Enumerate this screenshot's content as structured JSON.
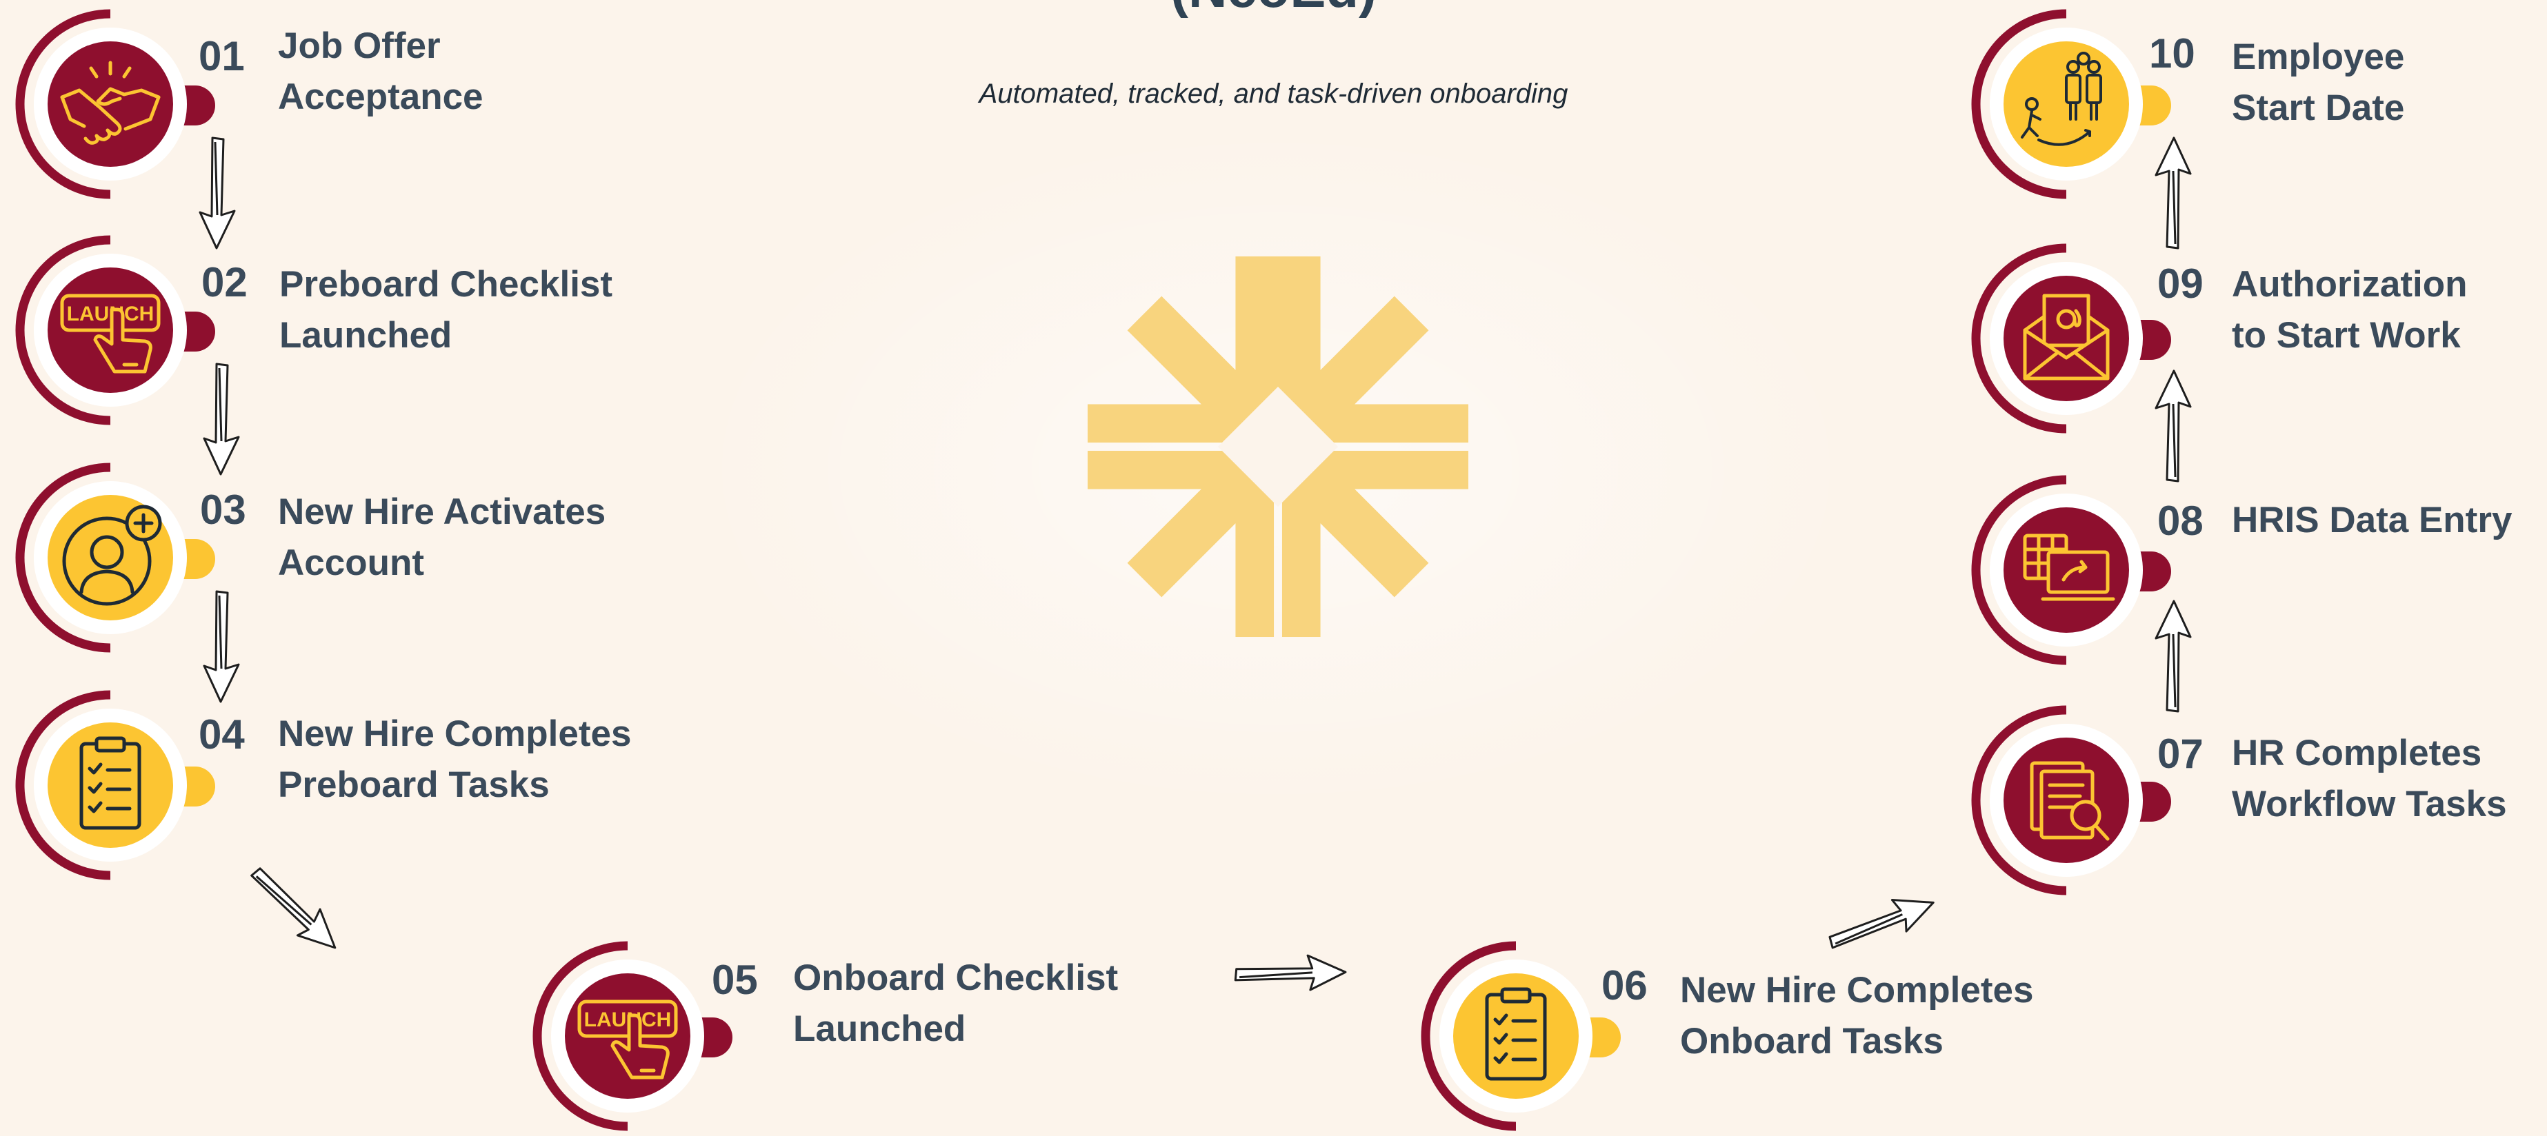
{
  "title": "(NeoEd)",
  "subtitle": "Automated, tracked, and task-driven onboarding",
  "colors": {
    "maroon": "#8e0f2e",
    "gold": "#fcc532",
    "text": "#3a4a5a",
    "background": "#fcf4eb",
    "logo": "#f8d47e"
  },
  "steps": [
    {
      "num": "01",
      "line1": "Job Offer",
      "line2": "Acceptance",
      "icon": "handshake-icon",
      "fill": "maroon"
    },
    {
      "num": "02",
      "line1": "Preboard Checklist",
      "line2": "Launched",
      "icon": "launch-button-icon",
      "fill": "maroon"
    },
    {
      "num": "03",
      "line1": "New Hire Activates",
      "line2": "Account",
      "icon": "add-user-icon",
      "fill": "gold"
    },
    {
      "num": "04",
      "line1": "New Hire Completes",
      "line2": "Preboard Tasks",
      "icon": "checklist-clipboard-icon",
      "fill": "gold"
    },
    {
      "num": "05",
      "line1": "Onboard Checklist",
      "line2": "Launched",
      "icon": "launch-button-icon",
      "fill": "maroon"
    },
    {
      "num": "06",
      "line1": "New Hire Completes",
      "line2": "Onboard Tasks",
      "icon": "checklist-clipboard-icon",
      "fill": "gold"
    },
    {
      "num": "07",
      "line1": "HR Completes",
      "line2": "Workflow Tasks",
      "icon": "document-search-icon",
      "fill": "maroon"
    },
    {
      "num": "08",
      "line1": "HRIS Data Entry",
      "line2": "",
      "icon": "data-entry-computer-icon",
      "fill": "maroon"
    },
    {
      "num": "09",
      "line1": "Authorization",
      "line2": "to Start Work",
      "icon": "email-envelope-icon",
      "fill": "maroon"
    },
    {
      "num": "10",
      "line1": "Employee",
      "line2": "Start Date",
      "icon": "team-onboarding-icon",
      "fill": "gold"
    }
  ]
}
